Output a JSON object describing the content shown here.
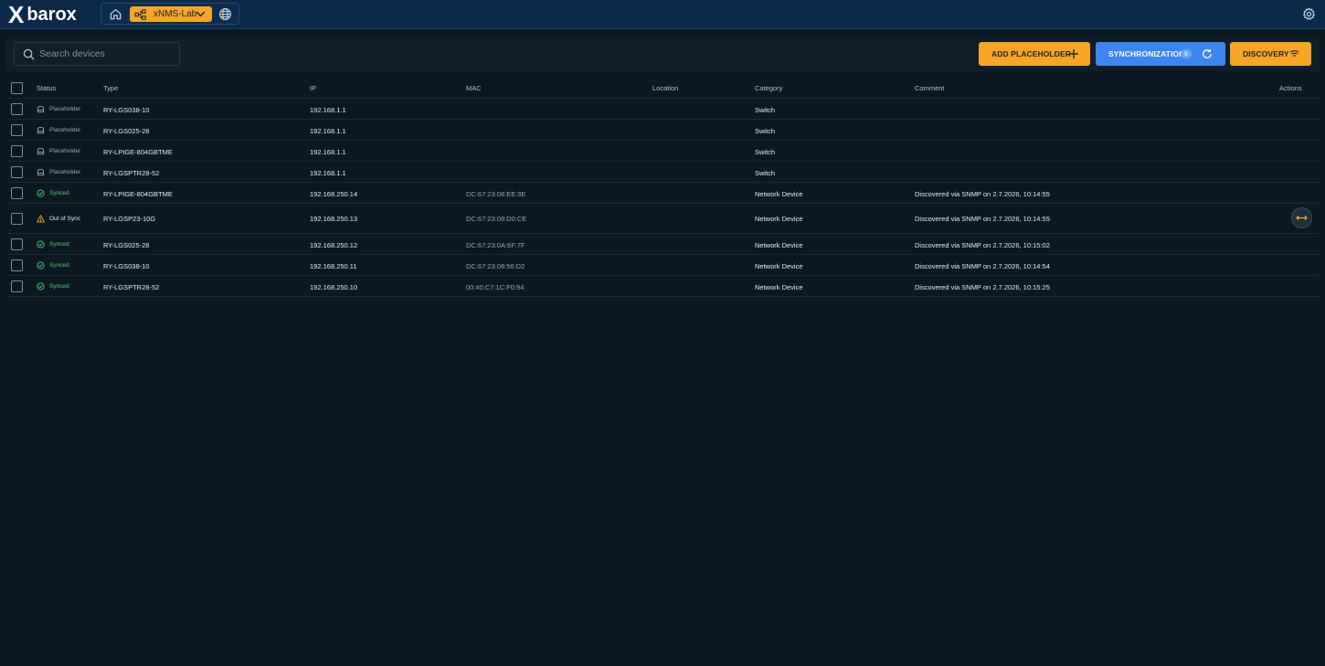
{
  "app": {
    "brand_mark": "X",
    "brand_name": "barox",
    "context_label": "xNMS-Lab",
    "icons": {
      "home": "home-icon",
      "network": "network-icon",
      "chevron": "chevron-down-icon",
      "globe": "globe-icon",
      "settings": "gear-icon"
    }
  },
  "toolbar": {
    "search_placeholder": "Search devices",
    "add_placeholder_label": "ADD PLACEHOLDER",
    "synchronization_label": "SYNCHRONIZATION",
    "synchronization_count": "5",
    "discovery_label": "DISCOVERY"
  },
  "colors": {
    "accent_orange": "#f5a623",
    "accent_blue": "#3b86f0",
    "synced_green": "#4ad077",
    "background": "#0b1822",
    "topbar": "#0c2a48"
  },
  "table": {
    "columns": [
      "Status",
      "Type",
      "IP",
      "MAC",
      "Location",
      "Category",
      "Comment",
      "Actions"
    ],
    "rows": [
      {
        "status": "Placeholder",
        "status_kind": "placeholder",
        "type": "RY-LGS038-10",
        "ip": "192.168.1.1",
        "mac": "",
        "location": "",
        "category": "Switch",
        "comment": ""
      },
      {
        "status": "Placeholder",
        "status_kind": "placeholder",
        "type": "RY-LGS025-28",
        "ip": "192.168.1.1",
        "mac": "",
        "location": "",
        "category": "Switch",
        "comment": ""
      },
      {
        "status": "Placeholder",
        "status_kind": "placeholder",
        "type": "RY-LPIGE-804GBTME",
        "ip": "192.168.1.1",
        "mac": "",
        "location": "",
        "category": "Switch",
        "comment": ""
      },
      {
        "status": "Placeholder",
        "status_kind": "placeholder",
        "type": "RY-LGSPTR28-52",
        "ip": "192.168.1.1",
        "mac": "",
        "location": "",
        "category": "Switch",
        "comment": ""
      },
      {
        "status": "Synced",
        "status_kind": "synced",
        "type": "RY-LPIGE-804GBTME",
        "ip": "192.168.250.14",
        "mac": "DC:67:23:08:EE:3E",
        "location": "",
        "category": "Network Device",
        "comment": "Discovered via SNMP on 2.7.2026, 10:14:55"
      },
      {
        "status": "Out of Sync",
        "status_kind": "out-of-sync",
        "type": "RY-LGSP23-10G",
        "ip": "192.168.250.13",
        "mac": "DC:67:23:08:D0:CE",
        "location": "",
        "category": "Network Device",
        "comment": "Discovered via SNMP on 2.7.2026, 10:14:55",
        "action_icon": "resolve-arrows-icon"
      },
      {
        "status": "Synced",
        "status_kind": "synced",
        "type": "RY-LGS025-28",
        "ip": "192.168.250.12",
        "mac": "DC:67:23:0A:6F:7F",
        "location": "",
        "category": "Network Device",
        "comment": "Discovered via SNMP on 2.7.2026, 10:15:02"
      },
      {
        "status": "Synced",
        "status_kind": "synced",
        "type": "RY-LGS038-10",
        "ip": "192.168.250.11",
        "mac": "DC:67:23:08:56:D2",
        "location": "",
        "category": "Network Device",
        "comment": "Discovered via SNMP on 2.7.2026, 10:14:54"
      },
      {
        "status": "Synced",
        "status_kind": "synced",
        "type": "RY-LGSPTR28-52",
        "ip": "192.168.250.10",
        "mac": "00:40:C7:1C:F0:94",
        "location": "",
        "category": "Network Device",
        "comment": "Discovered via SNMP on 2.7.2026, 10:15:25"
      }
    ]
  }
}
